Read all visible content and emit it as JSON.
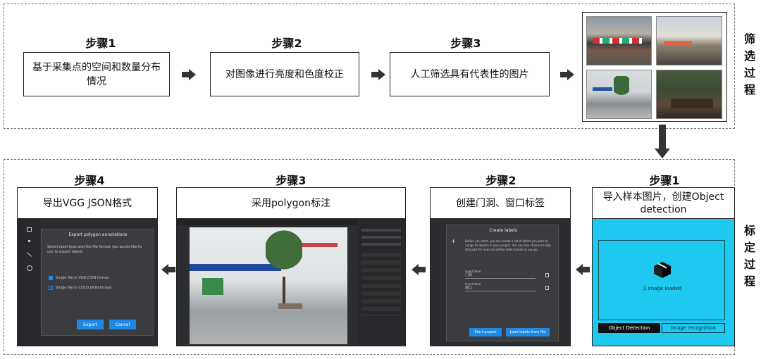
{
  "top_section": {
    "steps": [
      {
        "title": "步骤1",
        "text": "基于采集点的空间和数量分布情况"
      },
      {
        "title": "步骤2",
        "text": "对图像进行亮度和色度校正"
      },
      {
        "title": "步骤3",
        "text": "人工筛选具有代表性的图片"
      }
    ],
    "side_label": [
      "筛",
      "选",
      "过",
      "程"
    ]
  },
  "bottom_section": {
    "steps": [
      {
        "title": "步骤4",
        "text": "导出VGG JSON格式"
      },
      {
        "title": "步骤3",
        "text": "采用polygon标注"
      },
      {
        "title": "步骤2",
        "text": "创建门洞、窗口标签"
      },
      {
        "title": "步骤1",
        "text": "导入样本图片，创建Object detection"
      }
    ],
    "side_label": [
      "标",
      "定",
      "过",
      "程"
    ]
  },
  "export_dialog": {
    "title": "Export polygon annotations",
    "description": "Select label type and the file format you would like to use to export labels:",
    "option1": "Single file in VGG JSON format",
    "option2": "Single file in COCO JSON format",
    "export_label": "Export",
    "cancel_label": "Cancel"
  },
  "create_labels_dialog": {
    "title": "Create labels",
    "description": "Before you start, you can create a list of labels you plan to assign to objects in your project. You can also choose to skip that part for now and define label names as you go.",
    "insert1": "Insert label",
    "value1": "门洞",
    "insert2": "Insert label",
    "value2": "窗口",
    "start_label": "Start project",
    "load_label": "Load labels from file"
  },
  "import_panel": {
    "loaded_text": "1 image loaded",
    "object_detection": "Object Detection",
    "image_recognition": "Image recognition"
  },
  "colors": {
    "cyan": "#1ec8ee",
    "dark_ui": "#2b2d30",
    "blue_button": "#1e88e5"
  }
}
